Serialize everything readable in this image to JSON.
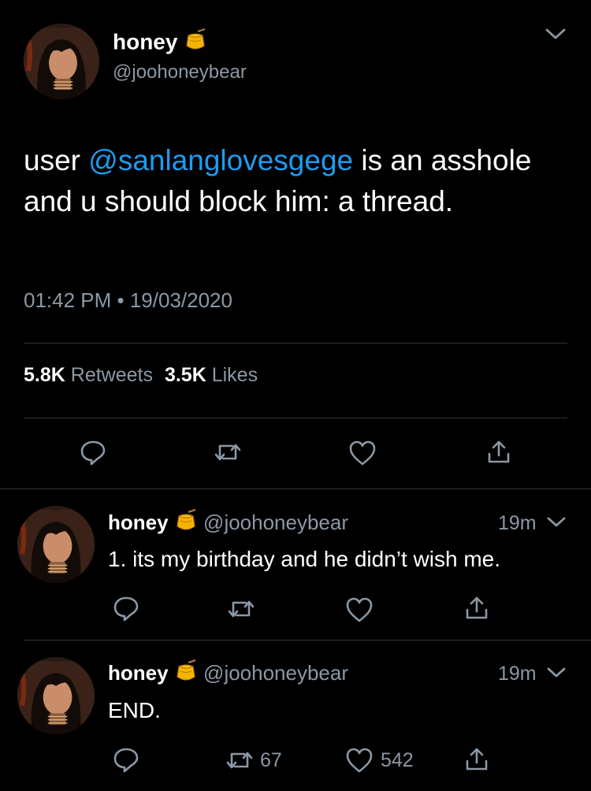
{
  "main_tweet": {
    "display_name": "honey",
    "handle": "@joohoneybear",
    "text_prefix": "user ",
    "mention": "@sanlanglovesgege",
    "text_suffix": " is an asshole and u should block him: a thread.",
    "timestamp": "01:42 PM • 19/03/2020",
    "retweets_count": "5.8K",
    "retweets_label": "Retweets",
    "likes_count": "3.5K",
    "likes_label": "Likes"
  },
  "replies": [
    {
      "display_name": "honey",
      "handle": "@joohoneybear",
      "time": "19m",
      "text": "1. its my birthday and he didn’t wish me."
    },
    {
      "display_name": "honey",
      "handle": "@joohoneybear",
      "time": "19m",
      "text": "END.",
      "retweets": "67",
      "likes": "542"
    }
  ],
  "colors": {
    "background": "#000000",
    "link": "#1d9bf0",
    "muted": "#8b98a5",
    "divider": "#2f3336"
  },
  "icons": [
    "honey-pot-icon",
    "chevron-down-icon",
    "reply-icon",
    "retweet-icon",
    "like-icon",
    "share-icon"
  ]
}
